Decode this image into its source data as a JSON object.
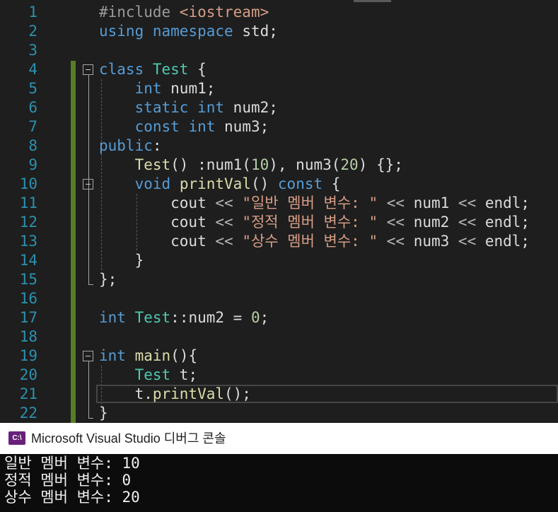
{
  "editor": {
    "lines": [
      {
        "n": "1",
        "tokens": [
          {
            "t": "#include ",
            "c": "pp"
          },
          {
            "t": "<iostream>",
            "c": "st"
          }
        ]
      },
      {
        "n": "2",
        "tokens": [
          {
            "t": "using",
            "c": "kw"
          },
          {
            "t": " ",
            "c": ""
          },
          {
            "t": "namespace",
            "c": "kw"
          },
          {
            "t": " std;",
            "c": ""
          }
        ]
      },
      {
        "n": "3",
        "tokens": []
      },
      {
        "n": "4",
        "tokens": [
          {
            "t": "class",
            "c": "kw"
          },
          {
            "t": " ",
            "c": ""
          },
          {
            "t": "Test",
            "c": "ty"
          },
          {
            "t": " {",
            "c": ""
          }
        ]
      },
      {
        "n": "5",
        "tokens": [
          {
            "t": "    ",
            "c": ""
          },
          {
            "t": "int",
            "c": "kw"
          },
          {
            "t": " num1;",
            "c": ""
          }
        ]
      },
      {
        "n": "6",
        "tokens": [
          {
            "t": "    ",
            "c": ""
          },
          {
            "t": "static",
            "c": "kw"
          },
          {
            "t": " ",
            "c": ""
          },
          {
            "t": "int",
            "c": "kw"
          },
          {
            "t": " num2;",
            "c": ""
          }
        ]
      },
      {
        "n": "7",
        "tokens": [
          {
            "t": "    ",
            "c": ""
          },
          {
            "t": "const",
            "c": "kw"
          },
          {
            "t": " ",
            "c": ""
          },
          {
            "t": "int",
            "c": "kw"
          },
          {
            "t": " num3;",
            "c": ""
          }
        ]
      },
      {
        "n": "8",
        "tokens": [
          {
            "t": "public",
            "c": "kw"
          },
          {
            "t": ":",
            "c": ""
          }
        ]
      },
      {
        "n": "9",
        "tokens": [
          {
            "t": "    ",
            "c": ""
          },
          {
            "t": "Test",
            "c": "fn"
          },
          {
            "t": "() :num1(",
            "c": ""
          },
          {
            "t": "10",
            "c": "nu"
          },
          {
            "t": "), num3(",
            "c": ""
          },
          {
            "t": "20",
            "c": "nu"
          },
          {
            "t": ") {};",
            "c": ""
          }
        ]
      },
      {
        "n": "10",
        "tokens": [
          {
            "t": "    ",
            "c": ""
          },
          {
            "t": "void",
            "c": "kw"
          },
          {
            "t": " ",
            "c": ""
          },
          {
            "t": "printVal",
            "c": "fn"
          },
          {
            "t": "() ",
            "c": ""
          },
          {
            "t": "const",
            "c": "kw"
          },
          {
            "t": " {",
            "c": ""
          }
        ]
      },
      {
        "n": "11",
        "tokens": [
          {
            "t": "        cout ",
            "c": ""
          },
          {
            "t": "<<",
            "c": "op"
          },
          {
            "t": " ",
            "c": ""
          },
          {
            "t": "\"일반 멤버 변수: \"",
            "c": "st"
          },
          {
            "t": " ",
            "c": ""
          },
          {
            "t": "<<",
            "c": "op"
          },
          {
            "t": " num1 ",
            "c": ""
          },
          {
            "t": "<<",
            "c": "op"
          },
          {
            "t": " endl;",
            "c": ""
          }
        ]
      },
      {
        "n": "12",
        "tokens": [
          {
            "t": "        cout ",
            "c": ""
          },
          {
            "t": "<<",
            "c": "op"
          },
          {
            "t": " ",
            "c": ""
          },
          {
            "t": "\"정적 멤버 변수: \"",
            "c": "st"
          },
          {
            "t": " ",
            "c": ""
          },
          {
            "t": "<<",
            "c": "op"
          },
          {
            "t": " num2 ",
            "c": ""
          },
          {
            "t": "<<",
            "c": "op"
          },
          {
            "t": " endl;",
            "c": ""
          }
        ]
      },
      {
        "n": "13",
        "tokens": [
          {
            "t": "        cout ",
            "c": ""
          },
          {
            "t": "<<",
            "c": "op"
          },
          {
            "t": " ",
            "c": ""
          },
          {
            "t": "\"상수 멤버 변수: \"",
            "c": "st"
          },
          {
            "t": " ",
            "c": ""
          },
          {
            "t": "<<",
            "c": "op"
          },
          {
            "t": " num3 ",
            "c": ""
          },
          {
            "t": "<<",
            "c": "op"
          },
          {
            "t": " endl;",
            "c": ""
          }
        ]
      },
      {
        "n": "14",
        "tokens": [
          {
            "t": "    }",
            "c": ""
          }
        ]
      },
      {
        "n": "15",
        "tokens": [
          {
            "t": "};",
            "c": ""
          }
        ]
      },
      {
        "n": "16",
        "tokens": []
      },
      {
        "n": "17",
        "tokens": [
          {
            "t": "int",
            "c": "kw"
          },
          {
            "t": " ",
            "c": ""
          },
          {
            "t": "Test",
            "c": "ty"
          },
          {
            "t": "::num2 = ",
            "c": ""
          },
          {
            "t": "0",
            "c": "nu"
          },
          {
            "t": ";",
            "c": ""
          }
        ]
      },
      {
        "n": "18",
        "tokens": []
      },
      {
        "n": "19",
        "tokens": [
          {
            "t": "int",
            "c": "kw"
          },
          {
            "t": " ",
            "c": ""
          },
          {
            "t": "main",
            "c": "fn"
          },
          {
            "t": "(){",
            "c": ""
          }
        ]
      },
      {
        "n": "20",
        "tokens": [
          {
            "t": "    ",
            "c": ""
          },
          {
            "t": "Test",
            "c": "ty"
          },
          {
            "t": " t;",
            "c": ""
          }
        ]
      },
      {
        "n": "21",
        "tokens": [
          {
            "t": "    t.",
            "c": ""
          },
          {
            "t": "printVal",
            "c": "fn"
          },
          {
            "t": "();",
            "c": ""
          }
        ]
      },
      {
        "n": "22",
        "tokens": [
          {
            "t": "}",
            "c": ""
          }
        ]
      }
    ]
  },
  "console": {
    "icon_label": "C:\\",
    "title": "Microsoft Visual Studio 디버그 콘솔",
    "output": [
      "일반 멤버 변수: 10",
      "정적 멤버 변수: 0",
      "상수 멤버 변수: 20"
    ]
  }
}
